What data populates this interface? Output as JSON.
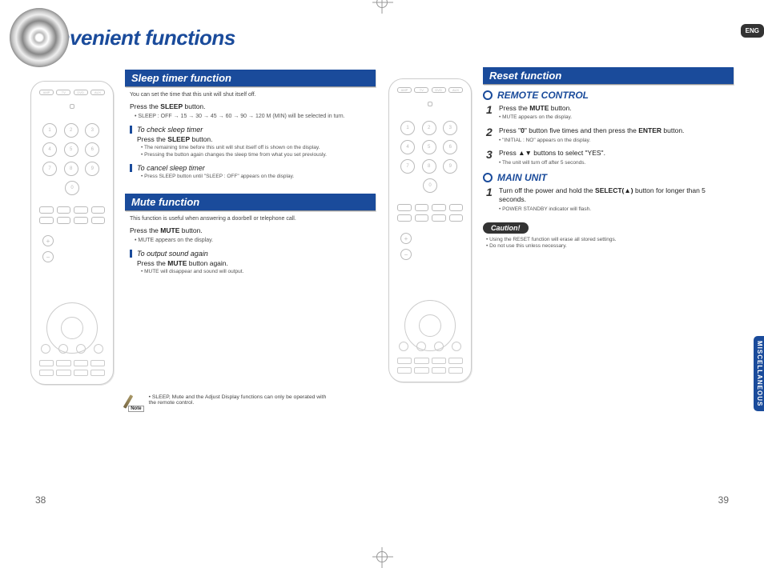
{
  "lang_tab": "ENG",
  "side_tab": "MISCELLANEOUS",
  "page_left_num": "38",
  "page_right_num": "39",
  "title": "Convenient functions",
  "sleep": {
    "heading": "Sleep timer function",
    "intro": "You can set the time that this unit will shut itself off.",
    "step": "Press the SLEEP button.",
    "step_note": "• SLEEP : OFF → 15 → 30 → 45 → 60 → 90 → 120 M (MIN) will be selected in turn.",
    "check_head": "To check sleep timer",
    "check_step": "Press the SLEEP button.",
    "check_b1": "The remaining time before this unit will shut itself off is shown on the display.",
    "check_b2": "Pressing the button again changes the sleep time from what you set previously.",
    "cancel_head": "To cancel sleep timer",
    "cancel_b1": "Press SLEEP button until \"SLEEP : OFF\" appears on the display."
  },
  "mute": {
    "heading": "Mute function",
    "intro": "This function is useful when answering a doorbell or telephone call.",
    "step": "Press the MUTE button.",
    "step_note": "• MUTE appears on the display.",
    "again_head": "To output sound again",
    "again_step": "Press the MUTE button again.",
    "again_b1": "MUTE will disappear and sound will output."
  },
  "footnote": {
    "label": "Note",
    "text": "SLEEP, Mute and the Adjust Display functions can only be operated with the remote control."
  },
  "reset": {
    "heading": "Reset function",
    "remote_head": "REMOTE CONTROL",
    "r1": "Press the MUTE button.",
    "r1n": "• MUTE appears on the display.",
    "r2": "Press \"0\" button five times and then press the ENTER button.",
    "r2n": "• \"INITIAL : NO\" appears on the display.",
    "r3": "Press ▲▼ buttons to select \"YES\".",
    "r3n": "• The unit will turn off after 5 seconds.",
    "main_head": "MAIN UNIT",
    "m1a": "Turn off the power and hold the ",
    "m1b": "SELECT(▲)",
    "m1c": " button for longer than 5 seconds.",
    "m1n": "• POWER STANDBY indicator will flash.",
    "caution_label": "Caution!",
    "c1": "Using the RESET function will erase all stored settings.",
    "c2": "Do not use this unless necessary."
  },
  "remote_top_btns": [
    "AMP",
    "TV",
    "DVD",
    "AUX"
  ]
}
